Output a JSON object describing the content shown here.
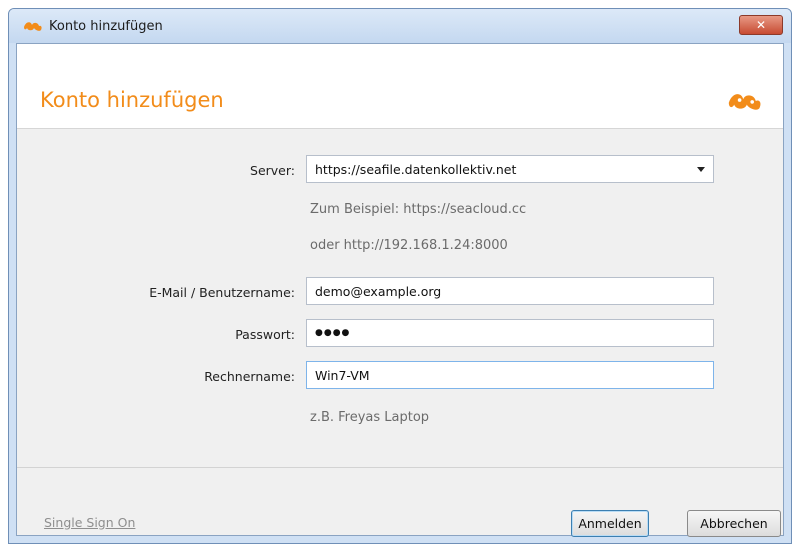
{
  "window": {
    "title": "Konto hinzufügen",
    "close_label": "✕"
  },
  "header": {
    "title": "Konto hinzufügen"
  },
  "form": {
    "server": {
      "label": "Server:",
      "value": "https://seafile.datenkollektiv.net",
      "hint1": "Zum Beispiel: https://seacloud.cc",
      "hint2": "oder http://192.168.1.24:8000"
    },
    "email": {
      "label": "E-Mail / Benutzername:",
      "value": "demo@example.org"
    },
    "password": {
      "label": "Passwort:",
      "value": "●●●●"
    },
    "computer": {
      "label": "Rechnername:",
      "value": "Win7-VM",
      "hint": "z.B. Freyas Laptop"
    }
  },
  "footer": {
    "sso_link": "Single Sign On",
    "login_button": "Anmelden",
    "cancel_button": "Abbrechen"
  },
  "colors": {
    "accent": "#f28c1a"
  },
  "icons": {
    "app": "seafile-logo-icon",
    "close": "close-icon",
    "dropdown": "chevron-down-icon"
  }
}
